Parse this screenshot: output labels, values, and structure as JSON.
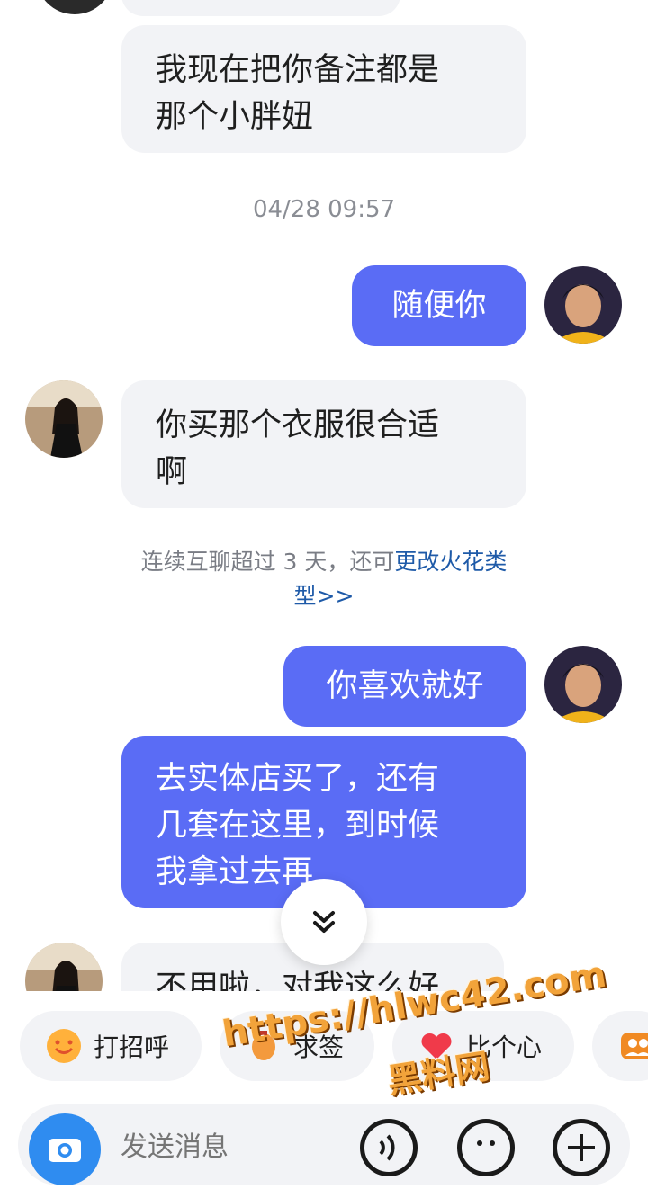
{
  "messages": {
    "m1": {
      "line1": "我现在把你备注都是",
      "line2": "那个小胖妞"
    },
    "timestamp": "04/28 09:57",
    "m2": {
      "text": "随便你"
    },
    "m3": {
      "line1": "你买那个衣服很合适",
      "line2": "啊"
    },
    "system_note": {
      "text": "连续互聊超过 3 天，还可",
      "link_part1": "更改火花类",
      "link_part2": "型>>"
    },
    "m4": {
      "text": "你喜欢就好"
    },
    "m5": {
      "line1": "去实体店买了，还有",
      "line2": "几套在这里，到时候",
      "line3": "我拿过去再"
    },
    "m6": {
      "text": "不用啦，对我这么好"
    }
  },
  "quick_actions": {
    "greet": "打招呼",
    "second": "求签",
    "heart": "比个心"
  },
  "input": {
    "placeholder": "发送消息"
  },
  "watermark": {
    "url": "https://hlwc42.com",
    "name": "黑料网"
  },
  "colors": {
    "outgoing": "#5a6cf5",
    "incoming": "#f2f3f6",
    "link": "#1e5aa8"
  },
  "icons": [
    "scroll-down-icon",
    "smile-face-icon",
    "lantern-icon",
    "heart-icon",
    "group-icon",
    "camera-icon",
    "voice-icon",
    "emoji-icon",
    "plus-icon"
  ]
}
